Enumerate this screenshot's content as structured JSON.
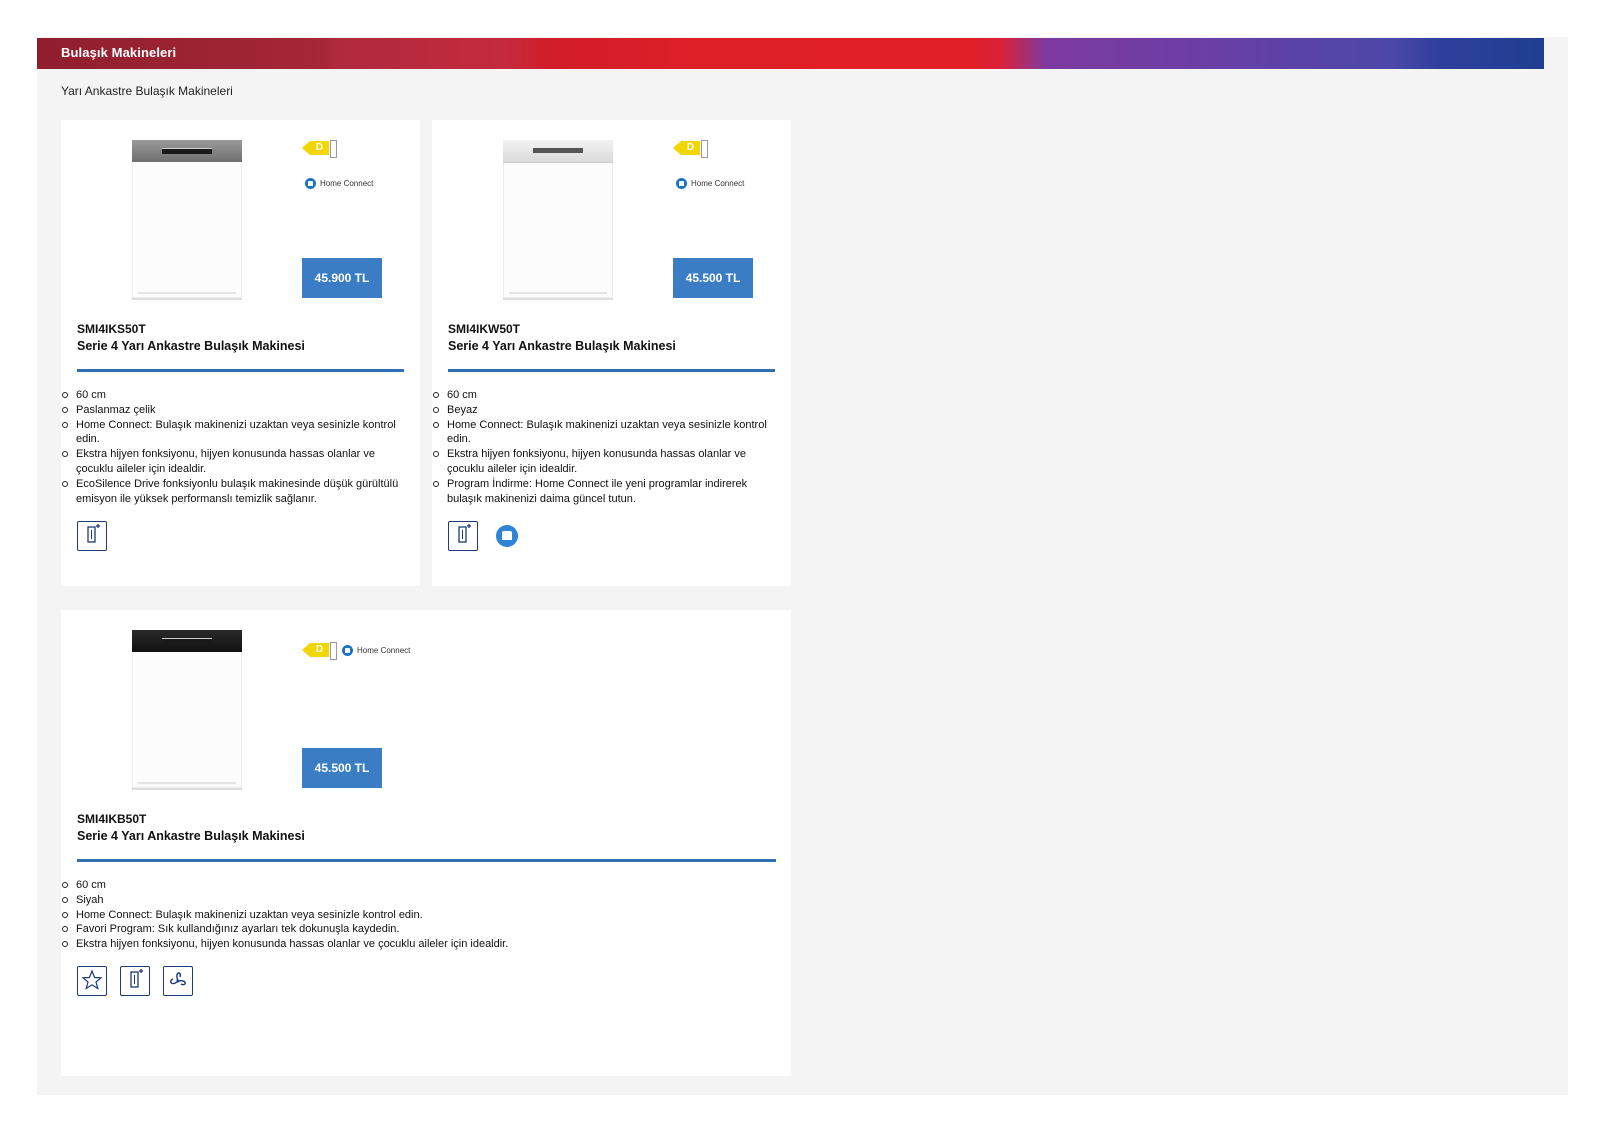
{
  "header": {
    "title": "Bulaşık Makineleri",
    "subtitle": "Yarı Ankastre Bulaşık Makineleri"
  },
  "colors": {
    "price_bg": "#3a7dc4",
    "rule": "#2f6fb0",
    "energy": "#f2d600"
  },
  "products": [
    {
      "energy_class": "D",
      "home_connect_label": "Home Connect",
      "price": "45.900 TL",
      "code": "SMI4IKS50T",
      "name": "Serie 4 Yarı Ankastre Bulaşık Makinesi",
      "features": [
        "60 cm",
        "Paslanmaz çelik",
        "Home Connect: Bulaşık makinenizi uzaktan veya sesinizle kontrol edin.",
        "Ekstra hijyen fonksiyonu, hijyen konusunda hassas olanlar ve çocuklu aileler için idealdir.",
        "EcoSilence Drive fonksiyonlu bulaşık makinesinde düşük gürültülü emisyon ile yüksek performanslı temizlik sağlanır."
      ]
    },
    {
      "energy_class": "D",
      "home_connect_label": "Home Connect",
      "price": "45.500 TL",
      "code": "SMI4IKW50T",
      "name": "Serie 4 Yarı Ankastre Bulaşık Makinesi",
      "features": [
        "60 cm",
        "Beyaz",
        "Home Connect: Bulaşık makinenizi uzaktan veya sesinizle kontrol edin.",
        "Ekstra hijyen fonksiyonu, hijyen konusunda hassas olanlar ve çocuklu aileler için idealdir.",
        "Program İndirme: Home Connect ile yeni programlar indirerek bulaşık makinenizi daima güncel tutun."
      ]
    },
    {
      "energy_class": "D",
      "home_connect_label": "Home Connect",
      "price": "45.500 TL",
      "code": "SMI4IKB50T",
      "name": "Serie 4 Yarı Ankastre Bulaşık Makinesi",
      "features": [
        "60 cm",
        "Siyah",
        "Home Connect: Bulaşık makinenizi uzaktan veya sesinizle kontrol edin.",
        "Favori Program: Sık kullandığınız ayarları tek dokunuşla kaydedin.",
        "Ekstra hijyen fonksiyonu, hijyen konusunda hassas olanlar ve çocuklu aileler için idealdir."
      ]
    }
  ]
}
